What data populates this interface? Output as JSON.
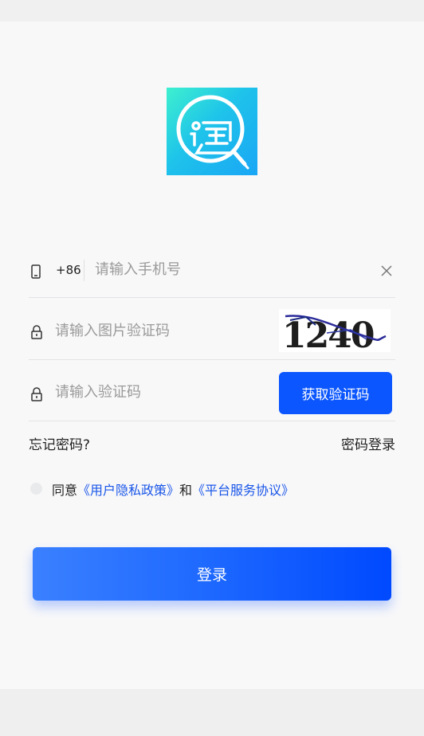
{
  "login": {
    "country_code": "+86",
    "phone_placeholder": "请输入手机号",
    "captcha_placeholder": "请输入图片验证码",
    "captcha_text": "1240",
    "sms_placeholder": "请输入验证码",
    "sms_button": "获取验证码",
    "forgot_password": "忘记密码?",
    "password_login": "密码登录",
    "agree_prefix": "同意",
    "privacy_policy": "《用户隐私政策》",
    "agree_and": "和",
    "service_agreement": "《平台服务协议》",
    "login_button": "登录"
  },
  "colors": {
    "primary": "#0B56FF",
    "link": "#1A56E8",
    "logo_gradient_start": "#3FF0CF",
    "logo_gradient_end": "#1AA6F5"
  },
  "icons": {
    "logo": "taobao-search-logo",
    "phone": "phone-icon",
    "lock": "lock-icon",
    "clear": "close-icon"
  }
}
